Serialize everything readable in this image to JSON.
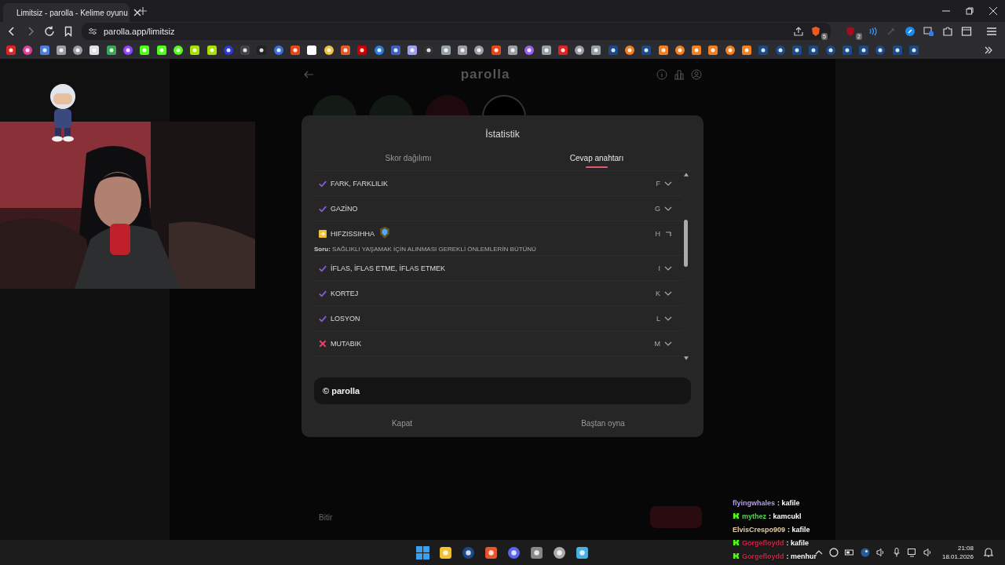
{
  "browser": {
    "tab": {
      "title": "Limitsiz - parolla - Kelime oyunu",
      "selected": true
    },
    "address": "parolla.app/limitsiz",
    "shield_count": "5",
    "extension_count": "2"
  },
  "page": {
    "logo": "parolla",
    "finish_button": "Bitir"
  },
  "modal": {
    "title": "İstatistik",
    "tabs": [
      {
        "label": "Skor dağılımı",
        "selected": false
      },
      {
        "label": "Cevap anahtarı",
        "selected": true
      }
    ],
    "answers": [
      {
        "word": "FARK, FARKLILIK",
        "letter": "F",
        "kind": "correct",
        "expanded": false
      },
      {
        "word": "GAZİNO",
        "letter": "G",
        "kind": "correct",
        "expanded": false
      },
      {
        "word": "HIFZISSIHHA",
        "letter": "H",
        "kind": "skipped",
        "expanded": true,
        "question": "**Soru:** SAĞLIKLI YAŞAMAK İÇİN ALINMASI GEREKLİ ÖNLEMLERİN BÜTÜNÜ"
      },
      {
        "word": "İFLAS, İFLAS ETME, İFLAS ETMEK",
        "letter": "I",
        "kind": "correct",
        "expanded": false
      },
      {
        "word": "KORTEJ",
        "letter": "K",
        "kind": "correct",
        "expanded": false
      },
      {
        "word": "LOSYON",
        "letter": "L",
        "kind": "correct",
        "expanded": false
      },
      {
        "word": "MUTABIK",
        "letter": "M",
        "kind": "wrong",
        "expanded": false
      }
    ],
    "footer": "© parolla",
    "buttons": [
      "Kapat",
      "Baştan oyna"
    ]
  },
  "chat": [
    {
      "user": "flyingwhales",
      "message": ": kafile",
      "color": "#b89cf0",
      "badge": false
    },
    {
      "user": "mythez",
      "message": ": kamcukl",
      "color": "#5fd35f",
      "badge": true
    },
    {
      "user": "ElvisCrespo909",
      "message": ": kafile",
      "color": "#e8d0a0",
      "badge": false
    },
    {
      "user": "Gorgefloydd",
      "message": ": kafile",
      "color": "#d0284a",
      "badge": true
    },
    {
      "user": "Gorgefloydd",
      "message": ": menhur",
      "color": "#d0284a",
      "badge": true
    }
  ],
  "taskbar": {
    "time": "21:08",
    "date": "18.01.2026"
  }
}
